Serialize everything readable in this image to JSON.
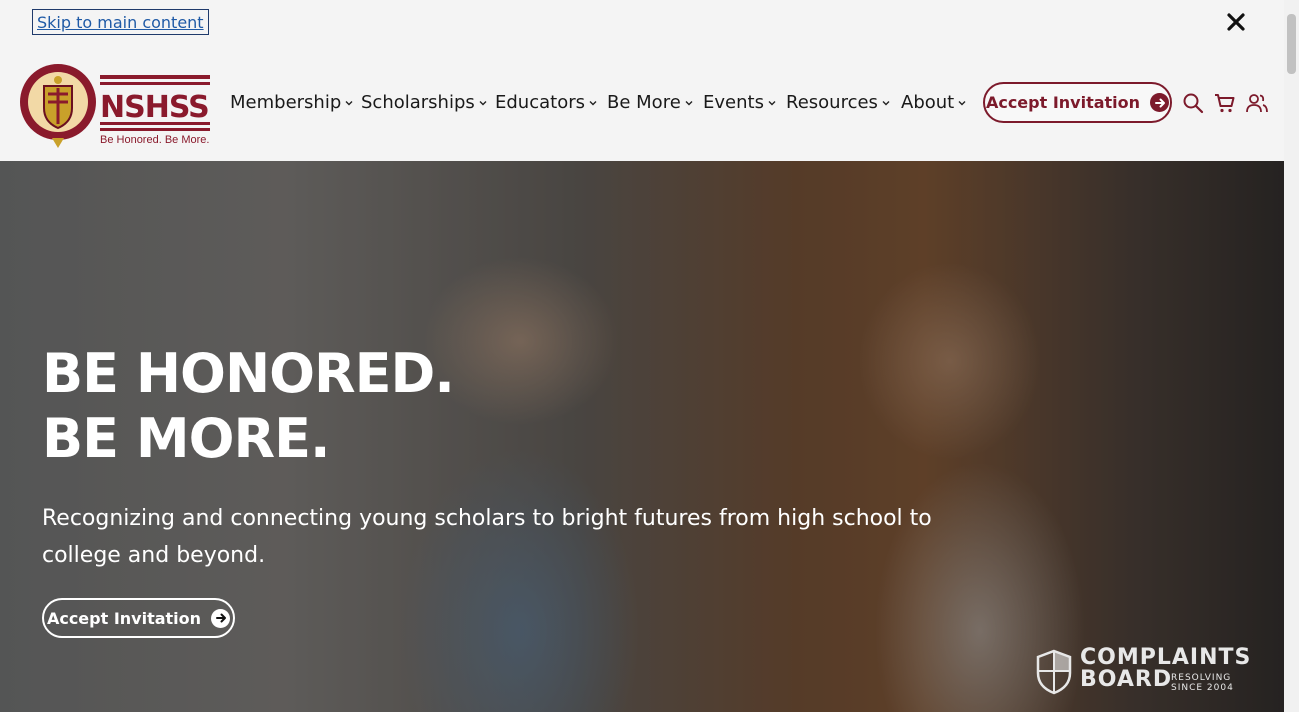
{
  "skip_link": "Skip to main content",
  "brand": {
    "name": "NSHSS",
    "tagline": "Be Honored. Be More.",
    "seal_text": "NATIONAL SOCIETY of HIGH SCHOOL SCHOLARS",
    "color": "#8a1a2c"
  },
  "nav": {
    "items": [
      {
        "label": "Membership"
      },
      {
        "label": "Scholarships"
      },
      {
        "label": "Educators"
      },
      {
        "label": "Be More"
      },
      {
        "label": "Events"
      },
      {
        "label": "Resources"
      },
      {
        "label": "About"
      }
    ],
    "accept_button": "Accept Invitation",
    "icons": [
      "search-icon",
      "cart-icon",
      "account-icon"
    ]
  },
  "hero": {
    "headline_line1": "BE HONORED.",
    "headline_line2": "BE MORE.",
    "subtext": "Recognizing and connecting young scholars to bright futures from high school to college and beyond.",
    "button": "Accept Invitation"
  },
  "badge": {
    "line1": "COMPLAINTS",
    "line2": "BOARD",
    "sub1": "RESOLVING",
    "sub2": "SINCE 2004"
  }
}
